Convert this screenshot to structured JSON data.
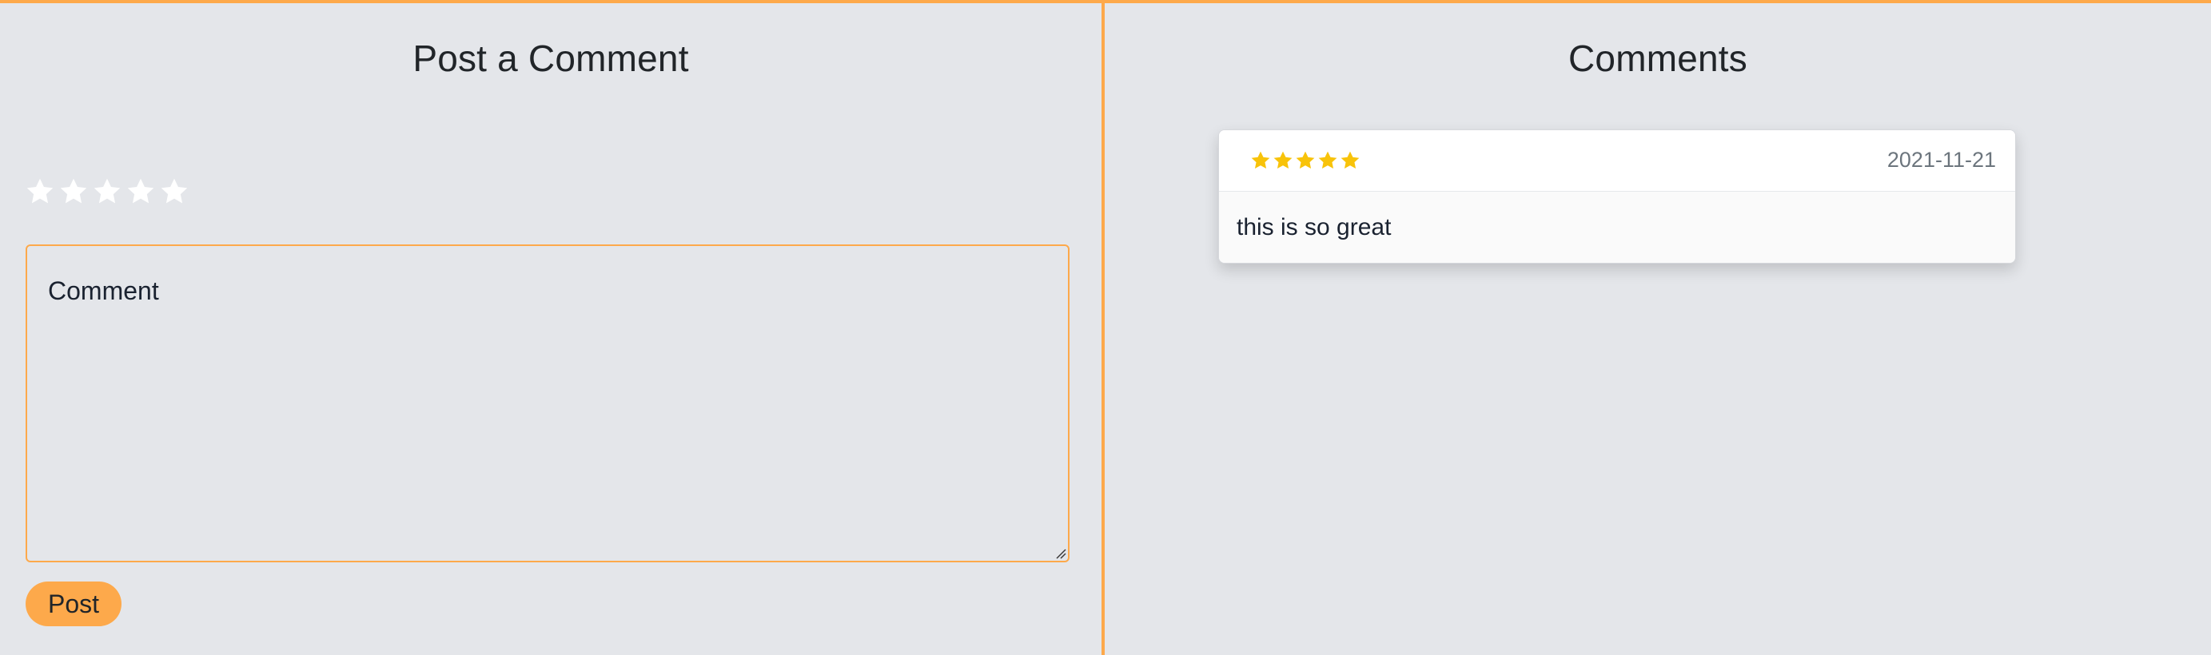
{
  "post_panel": {
    "title": "Post a Comment",
    "rating_stars": [
      "star-empty",
      "star-empty",
      "star-empty",
      "star-empty",
      "star-empty"
    ],
    "comment_placeholder": "Comment",
    "post_label": "Post"
  },
  "comments_panel": {
    "title": "Comments",
    "comments": [
      {
        "rating": 5,
        "date": "2021-11-21",
        "text": "this is so great"
      }
    ]
  },
  "colors": {
    "accent": "#fda94b",
    "background": "#e4e6ea",
    "star_filled": "#f8c30a",
    "star_empty": "#ffffff"
  }
}
